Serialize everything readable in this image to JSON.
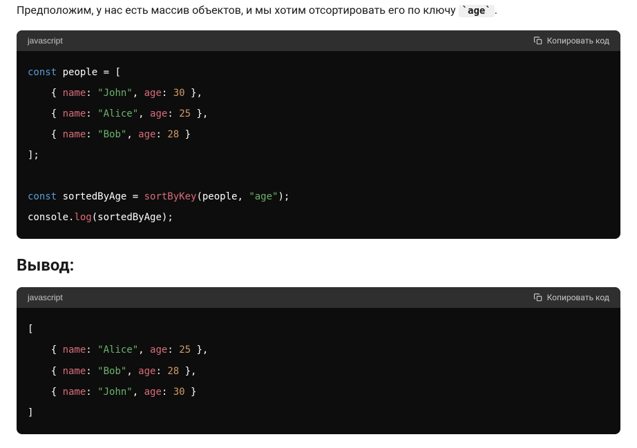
{
  "intro": {
    "prefix": "Предположим, у нас есть массив объектов, и мы хотим отсортировать его по ключу ",
    "code": "`age`",
    "suffix": "."
  },
  "block1": {
    "lang": "javascript",
    "copy_label": "Копировать код",
    "code": {
      "l1_kw": "const",
      "l1_var": " people = [",
      "l2_name_k": "name",
      "l2_name_v": "\"John\"",
      "l2_age_k": "age",
      "l2_age_v": "30",
      "l3_name_k": "name",
      "l3_name_v": "\"Alice\"",
      "l3_age_k": "age",
      "l3_age_v": "25",
      "l4_name_k": "name",
      "l4_name_v": "\"Bob\"",
      "l4_age_k": "age",
      "l4_age_v": "28",
      "l5": "];",
      "l6_kw": "const",
      "l6_var": " sortedByAge = ",
      "l6_fn": "sortByKey",
      "l6_args_open": "(people, ",
      "l6_str": "\"age\"",
      "l6_args_close": ");",
      "l7_obj": "console",
      "l7_dot": ".",
      "l7_method": "log",
      "l7_args": "(sortedByAge);"
    }
  },
  "heading": "Вывод:",
  "block2": {
    "lang": "javascript",
    "copy_label": "Копировать код",
    "code": {
      "l1": "[",
      "r1_name_k": "name",
      "r1_name_v": "\"Alice\"",
      "r1_age_k": "age",
      "r1_age_v": "25",
      "r2_name_k": "name",
      "r2_name_v": "\"Bob\"",
      "r2_age_k": "age",
      "r2_age_v": "28",
      "r3_name_k": "name",
      "r3_name_v": "\"John\"",
      "r3_age_k": "age",
      "r3_age_v": "30",
      "l5": "]"
    }
  }
}
